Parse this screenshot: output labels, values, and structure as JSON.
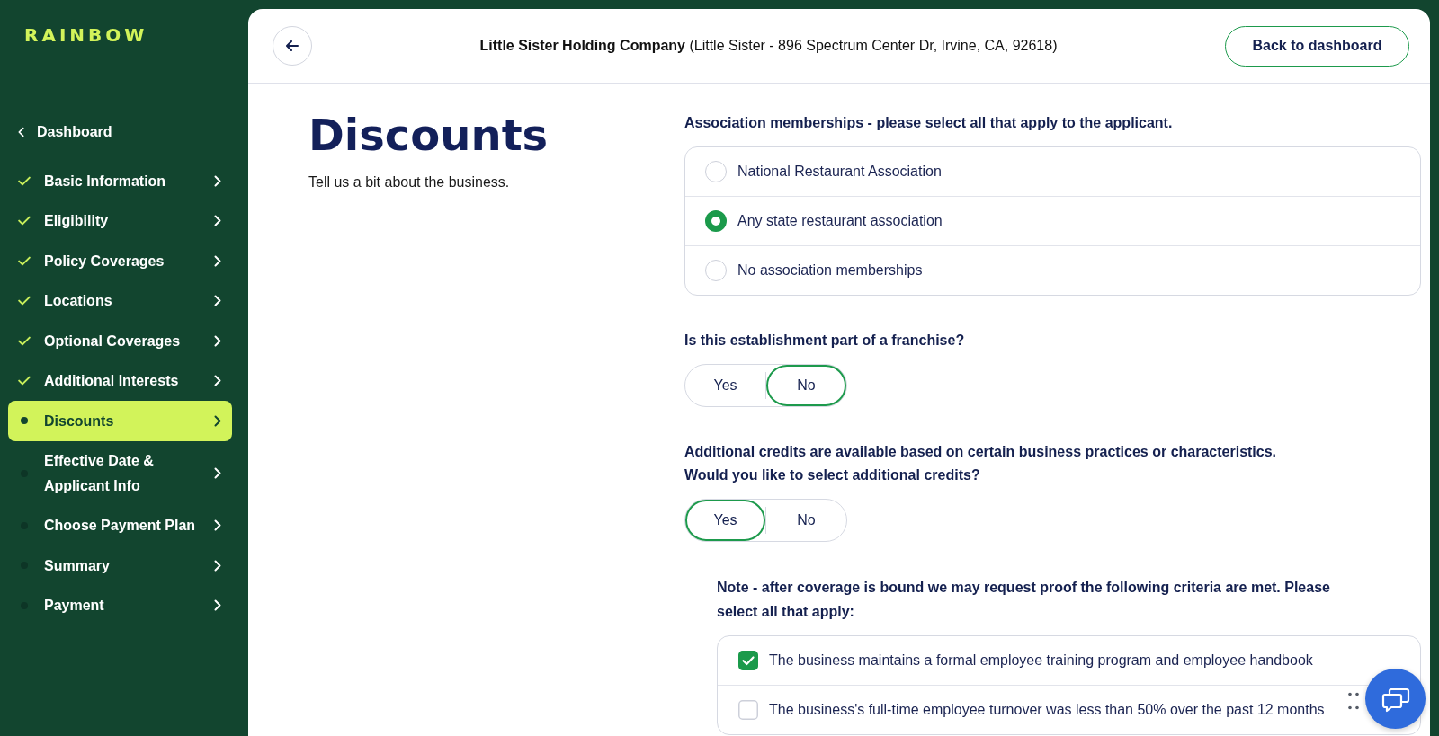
{
  "sidebar": {
    "logo": "RAINBOW",
    "back_link": "Dashboard",
    "steps": [
      {
        "label": "Basic Information",
        "completed": true,
        "selected": false
      },
      {
        "label": "Eligibility",
        "completed": true,
        "selected": false
      },
      {
        "label": "Policy Coverages",
        "completed": true,
        "selected": false
      },
      {
        "label": "Locations",
        "completed": true,
        "selected": false
      },
      {
        "label": "Optional Coverages",
        "completed": true,
        "selected": false
      },
      {
        "label": "Additional Interests",
        "completed": true,
        "selected": false
      },
      {
        "label": "Discounts",
        "completed": false,
        "selected": true
      },
      {
        "label": "Effective Date & Applicant Info",
        "completed": false,
        "selected": false
      },
      {
        "label": "Choose Payment Plan",
        "completed": false,
        "selected": false
      },
      {
        "label": "Summary",
        "completed": false,
        "selected": false
      },
      {
        "label": "Payment",
        "completed": false,
        "selected": false
      }
    ]
  },
  "header": {
    "title": "**Little Sister Holding Company** (Little Sister - 896 Spectrum Center Dr, Irvine, CA, 92618)",
    "back_button": "Back to dashboard"
  },
  "page": {
    "title": "Discounts",
    "subtitle": "Tell us a bit about the business."
  },
  "questions": [
    {
      "kind": "radio_list",
      "prompt": "Association memberships - please select all that apply to the applicant.",
      "options": [
        {
          "label": "National Restaurant Association",
          "selected": false
        },
        {
          "label": "Any state restaurant association",
          "selected": true
        },
        {
          "label": "No association memberships",
          "selected": false
        }
      ]
    },
    {
      "kind": "toggle",
      "prompt": "Is this establishment part of a franchise?",
      "options": [
        {
          "label": "Yes",
          "selected": false
        },
        {
          "label": "No",
          "selected": true
        }
      ]
    },
    {
      "kind": "toggle",
      "prompt": "Additional credits are available based on certain business practices or characteristics.\nWould you like to select additional credits?",
      "options": [
        {
          "label": "Yes",
          "selected": true
        },
        {
          "label": "No",
          "selected": false
        }
      ]
    },
    {
      "kind": "checkbox_list",
      "prompt": "Note - after coverage is bound we may request proof the following criteria are met. Please select all that apply:",
      "options": [
        {
          "label": "The business maintains a formal employee training program and employee handbook",
          "checked": true
        },
        {
          "label": "The business's full-time employee turnover was less than 50% over the past 12 months",
          "checked": false
        }
      ]
    }
  ]
}
